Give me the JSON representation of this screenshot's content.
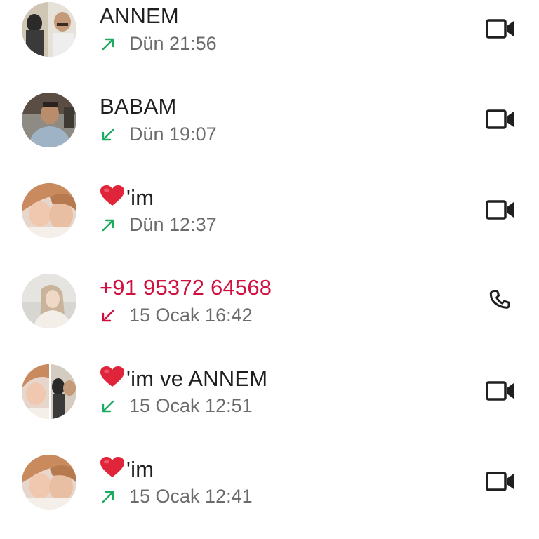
{
  "calls": [
    {
      "name": "ANNEM",
      "time": "Dün 21:56",
      "direction": "outgoing",
      "type": "video",
      "missed": false,
      "heart": false
    },
    {
      "name": "BABAM",
      "time": "Dün 19:07",
      "direction": "incoming",
      "type": "video",
      "missed": false,
      "heart": false
    },
    {
      "name": "'im",
      "time": "Dün 12:37",
      "direction": "outgoing",
      "type": "video",
      "missed": false,
      "heart": true
    },
    {
      "name": "+91 95372 64568",
      "time": "15 Ocak 16:42",
      "direction": "missed",
      "type": "voice",
      "missed": true,
      "heart": false
    },
    {
      "name": "'im ve ANNEM",
      "time": "15 Ocak 12:51",
      "direction": "incoming",
      "type": "video",
      "missed": false,
      "heart": true
    },
    {
      "name": "'im",
      "time": "15 Ocak 12:41",
      "direction": "outgoing",
      "type": "video",
      "missed": false,
      "heart": true
    }
  ],
  "colors": {
    "outgoing": "#1daa61",
    "incoming": "#1daa61",
    "missed": "#d0103e",
    "name": "#1f1f1f",
    "meta": "#6b6b6b",
    "icon": "#1f1f1f",
    "heart": "#e0243a"
  },
  "icons": {
    "video": "video-call-icon",
    "voice": "phone-call-icon",
    "outgoing": "arrow-up-right-icon",
    "incoming": "arrow-down-left-icon",
    "heart": "red-heart-icon"
  }
}
